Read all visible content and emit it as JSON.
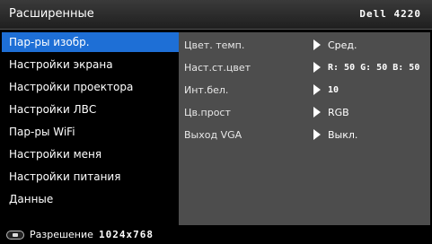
{
  "header": {
    "title": "Расширенные",
    "model": "Dell 4220"
  },
  "sidebar": {
    "items": [
      {
        "label": "Пар-ры изобр."
      },
      {
        "label": "Настройки экрана"
      },
      {
        "label": "Настройки проектора"
      },
      {
        "label": "Настройки ЛВС"
      },
      {
        "label": "Пар-ры WiFi"
      },
      {
        "label": "Настройки меня"
      },
      {
        "label": "Настройки питания"
      },
      {
        "label": "Данные"
      }
    ]
  },
  "settings": [
    {
      "label": "Цвет. темп.",
      "value": "Сред."
    },
    {
      "label": "Наст.ст.цвет",
      "value": "R: 50 G: 50 B: 50"
    },
    {
      "label": "Инт.бел.",
      "value": "10"
    },
    {
      "label": "Цв.прост",
      "value": "RGB"
    },
    {
      "label": "Выход VGA",
      "value": "Выкл."
    }
  ],
  "footer": {
    "label": "Разрешение",
    "value": "1024x768"
  }
}
